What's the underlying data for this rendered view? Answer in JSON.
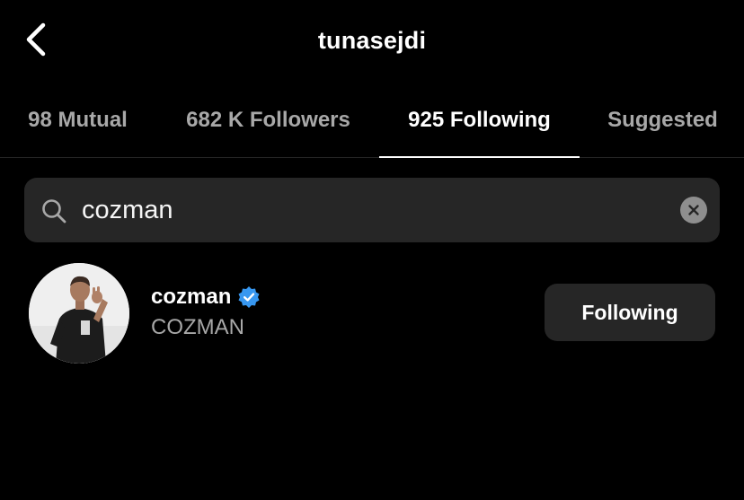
{
  "header": {
    "title": "tunasejdi",
    "back_icon": "chevron-left-icon"
  },
  "tabs": [
    {
      "label": "98 Mutual",
      "active": false
    },
    {
      "label": "682 K Followers",
      "active": false
    },
    {
      "label": "925 Following",
      "active": true
    },
    {
      "label": "Suggested",
      "active": false
    }
  ],
  "search": {
    "value": "cozman",
    "icon": "search-icon",
    "clear_icon": "clear-icon"
  },
  "results": [
    {
      "username": "cozman",
      "full_name": "COZMAN",
      "verified": true,
      "button_label": "Following"
    }
  ],
  "colors": {
    "background": "#000000",
    "surface": "#262626",
    "text_primary": "#ffffff",
    "text_secondary": "#a8a8a8",
    "verified_blue": "#3797f0"
  }
}
